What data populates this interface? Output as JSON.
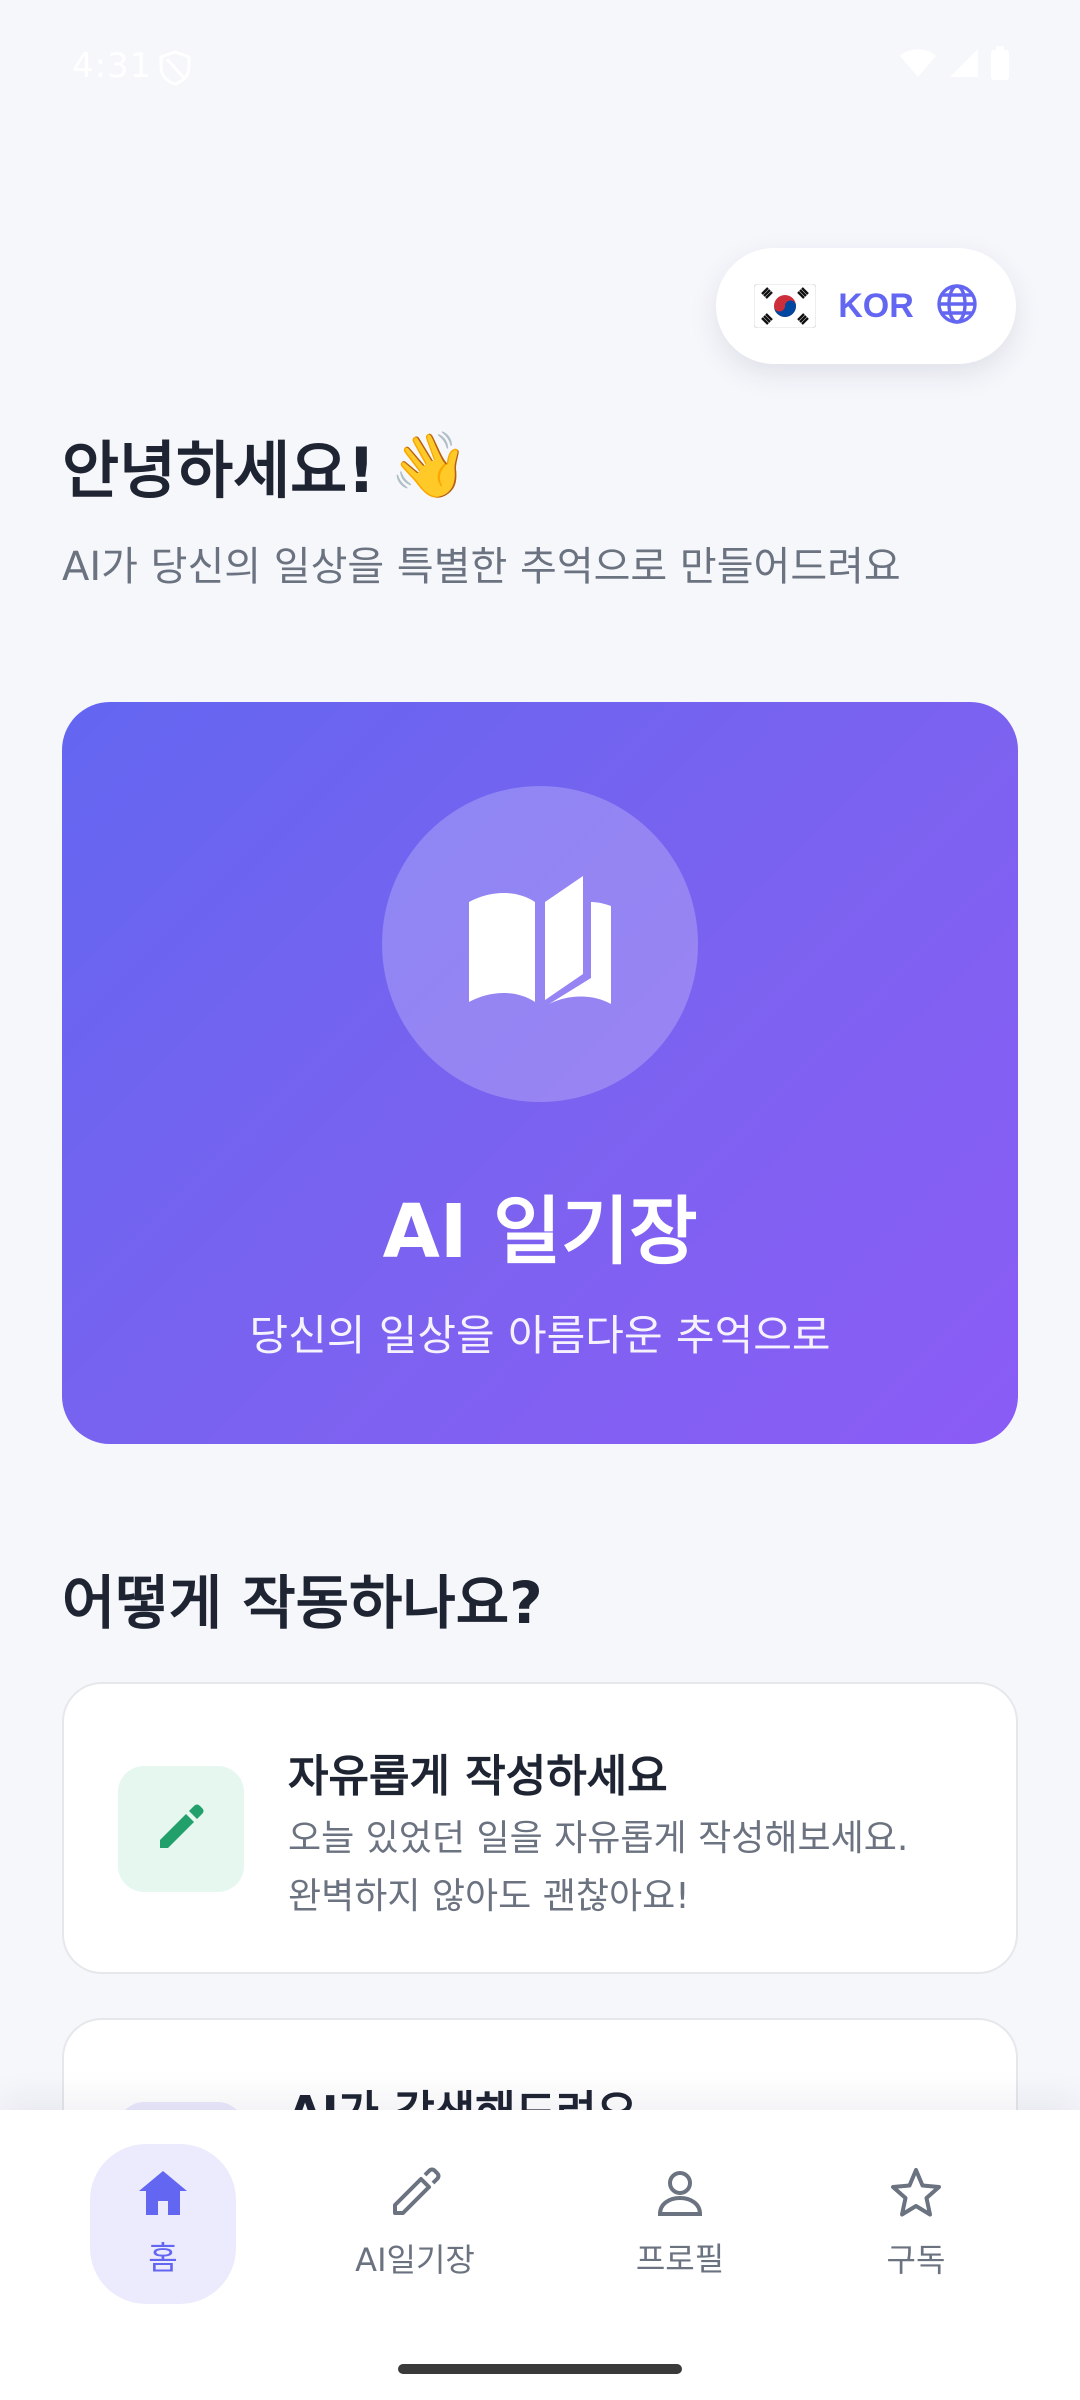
{
  "status_bar": {
    "time": "4:31",
    "icons": [
      "vpn-shield-icon",
      "wifi-icon",
      "signal-icon",
      "battery-icon"
    ]
  },
  "language": {
    "code": "KOR",
    "flag": "south-korea-flag-icon",
    "icon": "globe-icon"
  },
  "greeting": {
    "title": "안녕하세요!",
    "emoji": "👋",
    "subtitle": "AI가 당신의 일상을 특별한 추억으로 만들어드려요"
  },
  "hero": {
    "icon": "open-book-icon",
    "title": "AI 일기장",
    "subtitle": "당신의 일상을 아름다운 추억으로"
  },
  "how_it_works": {
    "title": "어떻게 작동하나요?",
    "cards": [
      {
        "icon": "pencil-icon",
        "title": "자유롭게 작성하세요",
        "desc_line1": "오늘 있었던 일을 자유롭게 작성해보세요.",
        "desc_line2": "완벽하지 않아도 괜찮아요!"
      },
      {
        "icon": "sparkle-icon",
        "title": "AI가 각색해드려요"
      }
    ]
  },
  "bottom_nav": {
    "items": [
      {
        "label": "홈",
        "icon": "home-icon",
        "active": true
      },
      {
        "label": "AI일기장",
        "icon": "pencil-icon",
        "active": false
      },
      {
        "label": "프로필",
        "icon": "person-icon",
        "active": false
      },
      {
        "label": "구독",
        "icon": "star-icon",
        "active": false
      }
    ]
  },
  "colors": {
    "accent": "#6366f1",
    "hero_gradient_start": "#6366f1",
    "hero_gradient_end": "#8b5cf6",
    "green_icon": "#22a06b",
    "background": "#f6f7fb"
  }
}
